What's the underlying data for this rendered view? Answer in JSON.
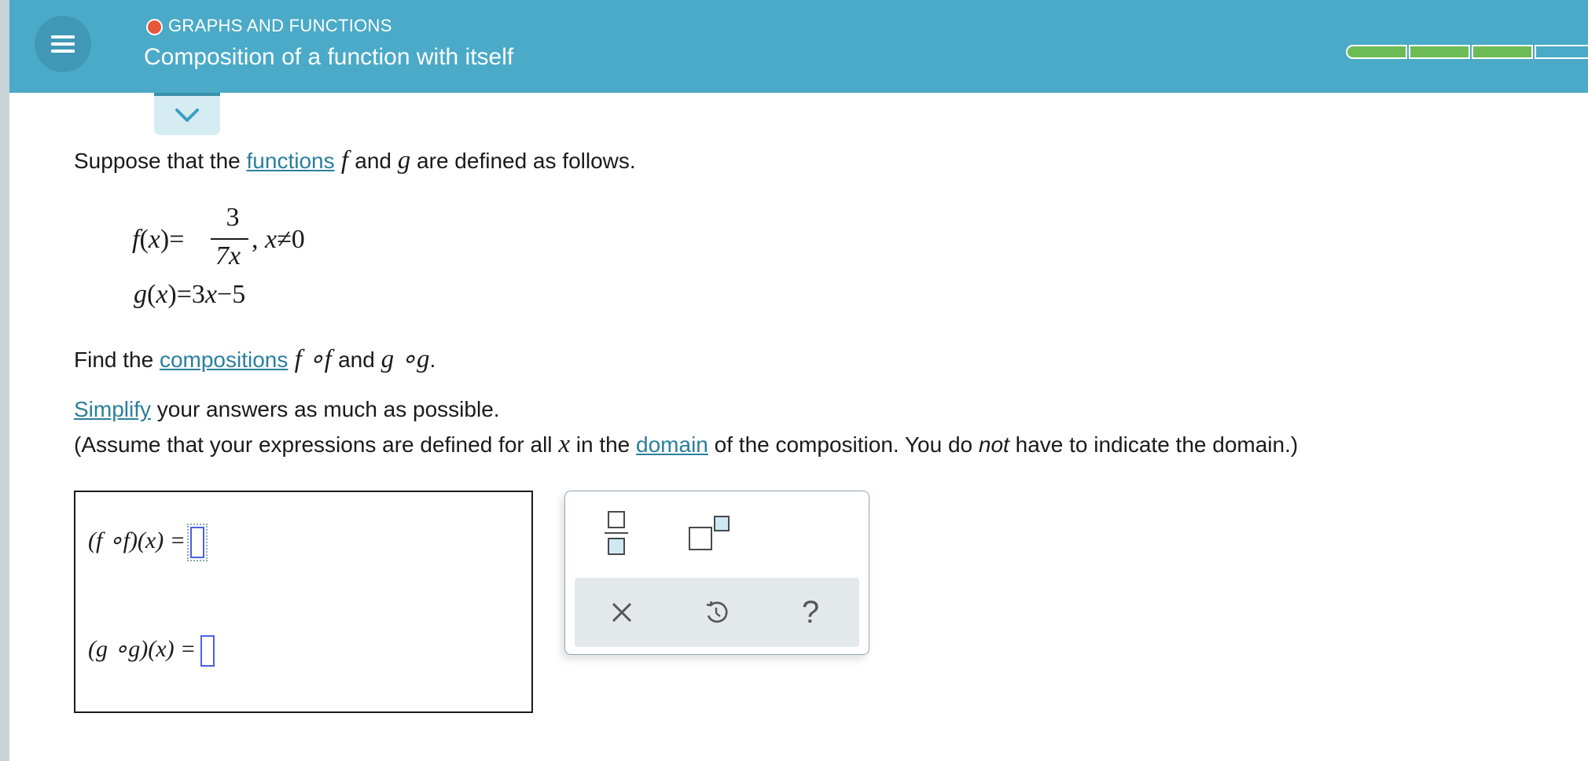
{
  "header": {
    "topic": "GRAPHS AND FUNCTIONS",
    "title": "Composition of a function with itself",
    "progress": {
      "completed_segments": 3,
      "total_visible_segments": 4
    }
  },
  "problem": {
    "intro_before": "Suppose that the ",
    "intro_link": "functions",
    "intro_after": " are defined as follows.",
    "f_def": {
      "lhs": "f(x)=",
      "numerator": "3",
      "denominator": "7x",
      "condition": "x≠0"
    },
    "g_def": "g(x)=3x−5",
    "find_before": "Find the ",
    "find_link": "compositions",
    "simplify_link": "Simplify",
    "simplify_after": " your answers as much as possible.",
    "assume_before": "(Assume that your expressions are defined for all ",
    "assume_var": "x",
    "assume_middle": " in the ",
    "assume_link": "domain",
    "assume_after": " of the composition. You do ",
    "assume_not": "not",
    "assume_end": " have to indicate the domain.)"
  },
  "answers": {
    "fof_label": "(f ∘f)(x) =",
    "gog_label": "(g ∘g)(x) =",
    "fof_value": "",
    "gog_value": ""
  },
  "palette": {
    "tools": [
      "fraction-icon",
      "exponent-icon"
    ],
    "actions": [
      "clear-icon",
      "undo-icon",
      "help-icon"
    ],
    "help_label": "?"
  },
  "colors": {
    "header": "#4aaac8",
    "accent": "#2a7f9e",
    "progress_done": "#6dbb55",
    "topic_dot": "#e8593c",
    "input_border": "#4a62e0"
  }
}
